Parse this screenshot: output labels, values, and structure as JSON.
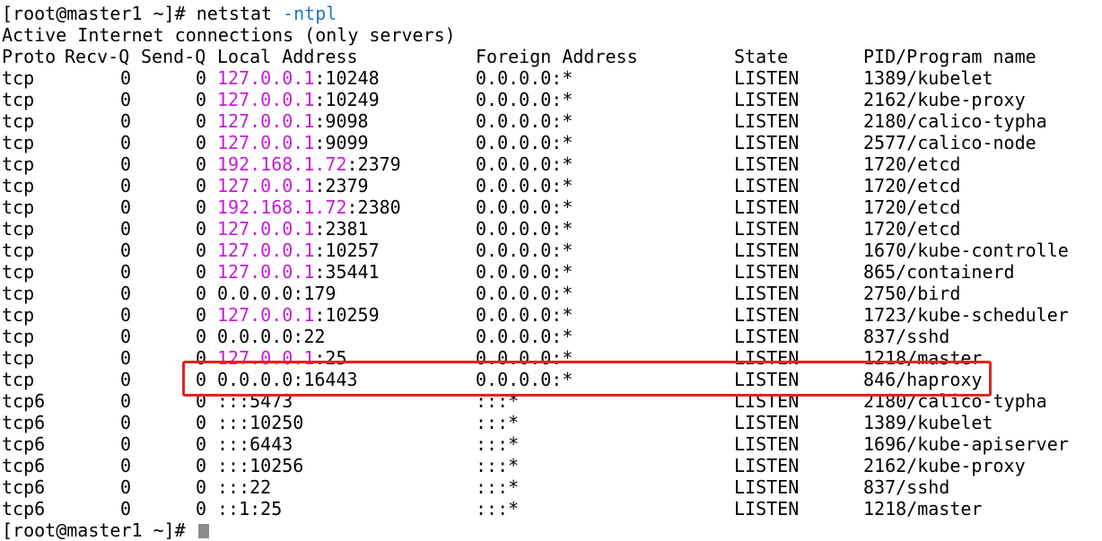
{
  "terminal": {
    "prompt": "[root@master1 ~]# ",
    "command": "netstat ",
    "command_flag": "-ntpl",
    "title_line": "Active Internet connections (only servers)",
    "end_prompt": "[root@master1 ~]# ",
    "headers": {
      "proto": "Proto",
      "recv": "Recv-Q",
      "send": "Send-Q",
      "local": "Local Address",
      "foreign": "Foreign Address",
      "state": "State",
      "pid": "PID/Program name"
    },
    "rows": [
      {
        "proto": "tcp",
        "recv": "0",
        "send": "0",
        "local_ip": "127.0.0.1",
        "local_rest": ":10248",
        "foreign": "0.0.0.0:*",
        "state": "LISTEN",
        "pid": "1389/kubelet"
      },
      {
        "proto": "tcp",
        "recv": "0",
        "send": "0",
        "local_ip": "127.0.0.1",
        "local_rest": ":10249",
        "foreign": "0.0.0.0:*",
        "state": "LISTEN",
        "pid": "2162/kube-proxy"
      },
      {
        "proto": "tcp",
        "recv": "0",
        "send": "0",
        "local_ip": "127.0.0.1",
        "local_rest": ":9098",
        "foreign": "0.0.0.0:*",
        "state": "LISTEN",
        "pid": "2180/calico-typha"
      },
      {
        "proto": "tcp",
        "recv": "0",
        "send": "0",
        "local_ip": "127.0.0.1",
        "local_rest": ":9099",
        "foreign": "0.0.0.0:*",
        "state": "LISTEN",
        "pid": "2577/calico-node"
      },
      {
        "proto": "tcp",
        "recv": "0",
        "send": "0",
        "local_ip": "192.168.1.72",
        "local_rest": ":2379",
        "foreign": "0.0.0.0:*",
        "state": "LISTEN",
        "pid": "1720/etcd"
      },
      {
        "proto": "tcp",
        "recv": "0",
        "send": "0",
        "local_ip": "127.0.0.1",
        "local_rest": ":2379",
        "foreign": "0.0.0.0:*",
        "state": "LISTEN",
        "pid": "1720/etcd"
      },
      {
        "proto": "tcp",
        "recv": "0",
        "send": "0",
        "local_ip": "192.168.1.72",
        "local_rest": ":2380",
        "foreign": "0.0.0.0:*",
        "state": "LISTEN",
        "pid": "1720/etcd"
      },
      {
        "proto": "tcp",
        "recv": "0",
        "send": "0",
        "local_ip": "127.0.0.1",
        "local_rest": ":2381",
        "foreign": "0.0.0.0:*",
        "state": "LISTEN",
        "pid": "1720/etcd"
      },
      {
        "proto": "tcp",
        "recv": "0",
        "send": "0",
        "local_ip": "127.0.0.1",
        "local_rest": ":10257",
        "foreign": "0.0.0.0:*",
        "state": "LISTEN",
        "pid": "1670/kube-controlle"
      },
      {
        "proto": "tcp",
        "recv": "0",
        "send": "0",
        "local_ip": "127.0.0.1",
        "local_rest": ":35441",
        "foreign": "0.0.0.0:*",
        "state": "LISTEN",
        "pid": "865/containerd"
      },
      {
        "proto": "tcp",
        "recv": "0",
        "send": "0",
        "local_ip": "",
        "local_rest": "0.0.0.0:179",
        "foreign": "0.0.0.0:*",
        "state": "LISTEN",
        "pid": "2750/bird"
      },
      {
        "proto": "tcp",
        "recv": "0",
        "send": "0",
        "local_ip": "127.0.0.1",
        "local_rest": ":10259",
        "foreign": "0.0.0.0:*",
        "state": "LISTEN",
        "pid": "1723/kube-scheduler"
      },
      {
        "proto": "tcp",
        "recv": "0",
        "send": "0",
        "local_ip": "",
        "local_rest": "0.0.0.0:22",
        "foreign": "0.0.0.0:*",
        "state": "LISTEN",
        "pid": "837/sshd"
      },
      {
        "proto": "tcp",
        "recv": "0",
        "send": "0",
        "local_ip": "127.0.0.1",
        "local_rest": ":25",
        "foreign": "0.0.0.0:*",
        "state": "LISTEN",
        "pid": "1218/master"
      },
      {
        "proto": "tcp",
        "recv": "0",
        "send": "0",
        "local_ip": "",
        "local_rest": "0.0.0.0:16443",
        "foreign": "0.0.0.0:*",
        "state": "LISTEN",
        "pid": "846/haproxy"
      },
      {
        "proto": "tcp6",
        "recv": "0",
        "send": "0",
        "local_ip": "",
        "local_rest": ":::5473",
        "foreign": ":::*",
        "state": "LISTEN",
        "pid": "2180/calico-typha"
      },
      {
        "proto": "tcp6",
        "recv": "0",
        "send": "0",
        "local_ip": "",
        "local_rest": ":::10250",
        "foreign": ":::*",
        "state": "LISTEN",
        "pid": "1389/kubelet"
      },
      {
        "proto": "tcp6",
        "recv": "0",
        "send": "0",
        "local_ip": "",
        "local_rest": ":::6443",
        "foreign": ":::*",
        "state": "LISTEN",
        "pid": "1696/kube-apiserver"
      },
      {
        "proto": "tcp6",
        "recv": "0",
        "send": "0",
        "local_ip": "",
        "local_rest": ":::10256",
        "foreign": ":::*",
        "state": "LISTEN",
        "pid": "2162/kube-proxy"
      },
      {
        "proto": "tcp6",
        "recv": "0",
        "send": "0",
        "local_ip": "",
        "local_rest": ":::22",
        "foreign": ":::*",
        "state": "LISTEN",
        "pid": "837/sshd"
      },
      {
        "proto": "tcp6",
        "recv": "0",
        "send": "0",
        "local_ip": "",
        "local_rest": "::1:25",
        "foreign": ":::*",
        "state": "LISTEN",
        "pid": "1218/master"
      }
    ]
  },
  "colors": {
    "background": "#ffffff",
    "text": "#000000",
    "ip_highlight": "#c81bd8",
    "command_flag": "#1e76c9",
    "annotation_box": "#e3231f"
  }
}
